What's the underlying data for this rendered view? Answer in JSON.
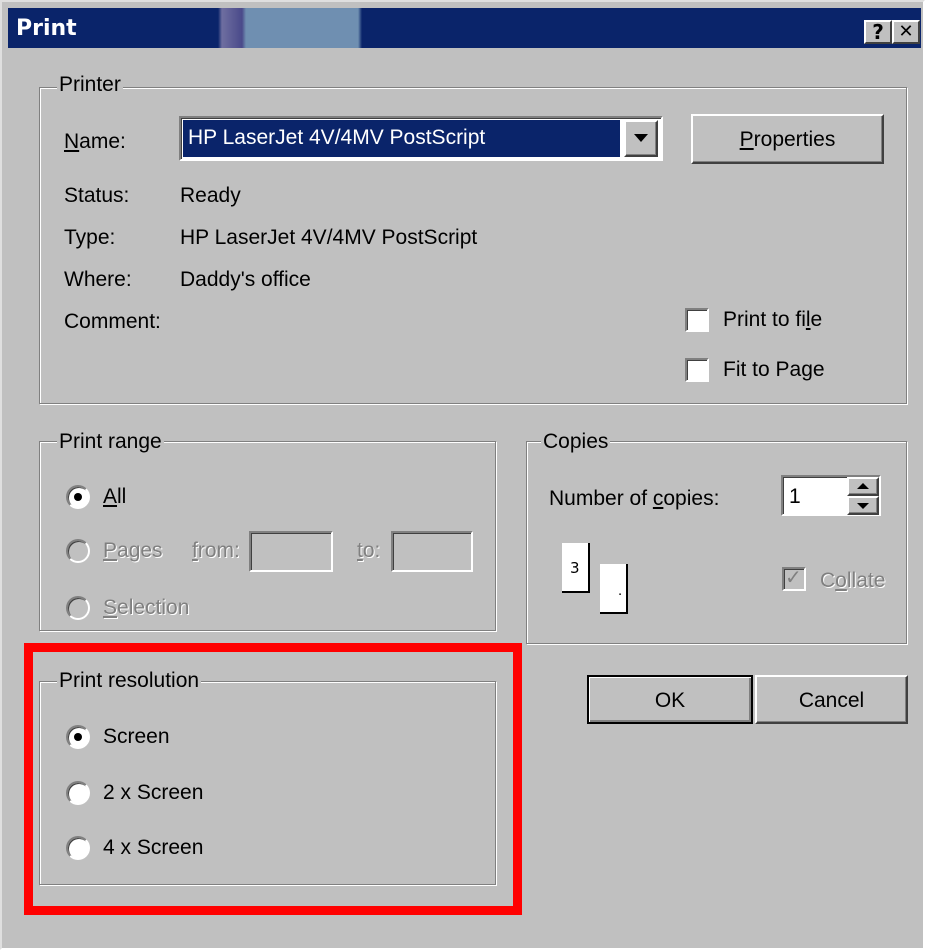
{
  "window": {
    "title": "Print",
    "help_btn": "?",
    "close_btn": "✕"
  },
  "printer": {
    "legend": "Printer",
    "name_label": "Name:",
    "name_value": "HP LaserJet 4V/4MV PostScript",
    "properties_label": "Properties",
    "status_label": "Status:",
    "status_value": "Ready",
    "type_label": "Type:",
    "type_value": "HP LaserJet 4V/4MV PostScript",
    "where_label": "Where:",
    "where_value": "Daddy's office",
    "comment_label": "Comment:",
    "print_to_file_label": "Print to file",
    "fit_to_page_label": "Fit to Page"
  },
  "print_range": {
    "legend": "Print range",
    "all_label": "All",
    "pages_label": "Pages",
    "from_label": "from:",
    "to_label": "to:",
    "selection_label": "Selection",
    "selected": "All"
  },
  "copies": {
    "legend": "Copies",
    "number_label": "Number of copies:",
    "number_value": "1",
    "collate_label": "Collate",
    "page_icon_label": "3",
    "collate_checked": true
  },
  "print_resolution": {
    "legend": "Print resolution",
    "options": [
      "Screen",
      "2 x Screen",
      "4 x Screen"
    ],
    "selected": "Screen"
  },
  "buttons": {
    "ok": "OK",
    "cancel": "Cancel"
  },
  "highlight_color": "#ff0000"
}
